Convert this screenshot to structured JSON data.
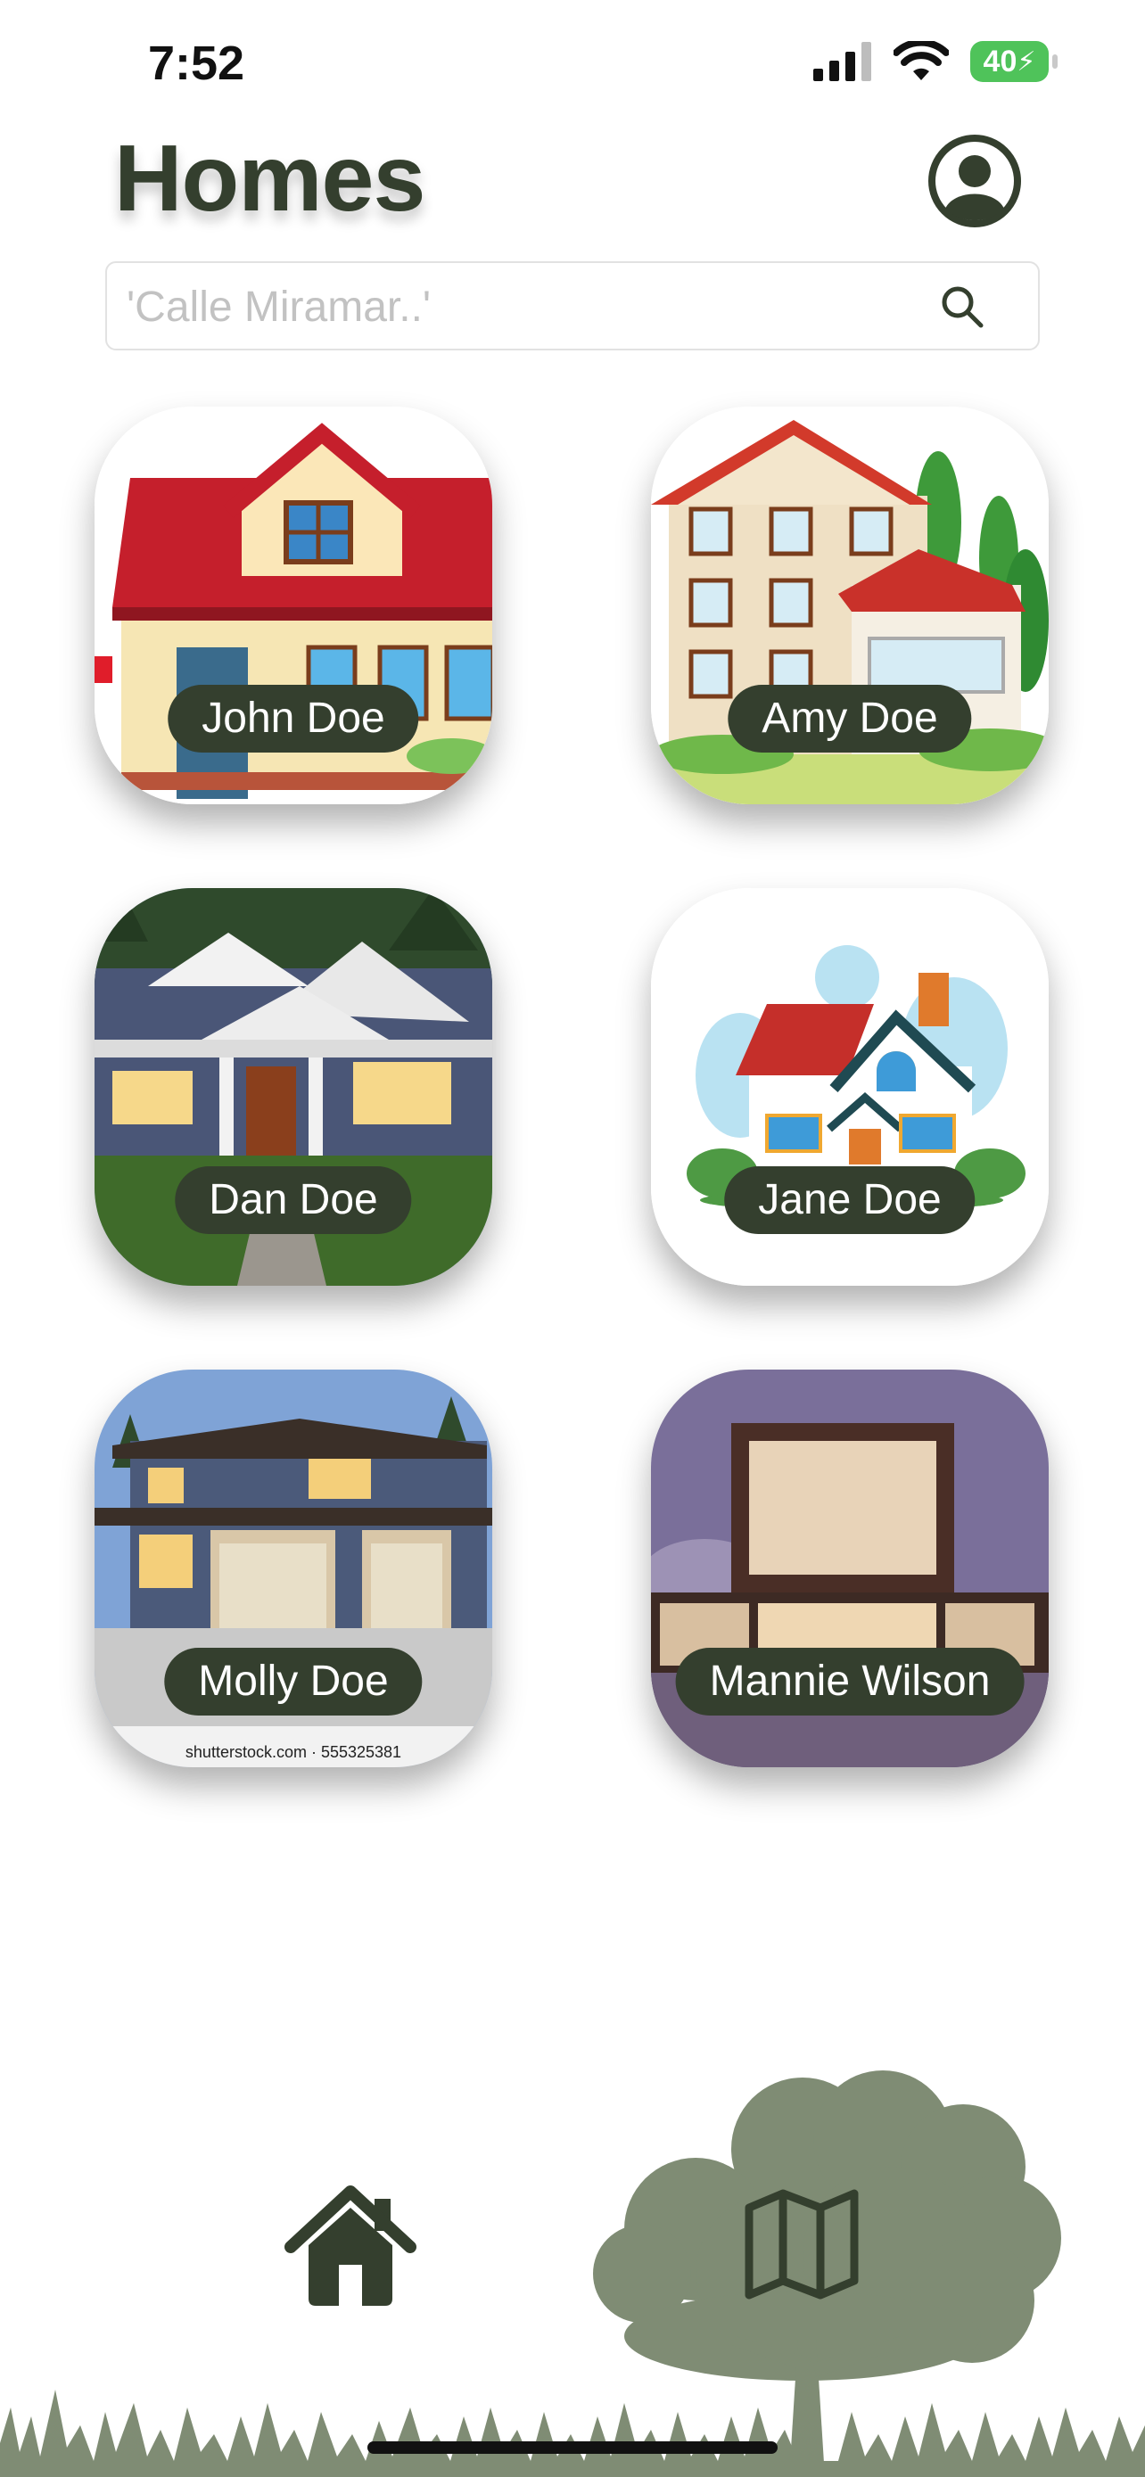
{
  "status_bar": {
    "time": "7:52",
    "battery": "40"
  },
  "header": {
    "title": "Homes"
  },
  "search": {
    "placeholder": "'Calle Miramar..'",
    "value": ""
  },
  "homes": [
    {
      "name": "John Doe"
    },
    {
      "name": "Amy Doe"
    },
    {
      "name": "Dan Doe"
    },
    {
      "name": "Jane Doe"
    },
    {
      "name": "Molly Doe",
      "watermark": "shutterstock.com · 555325381"
    },
    {
      "name": "Mannie Wilson"
    }
  ],
  "tab_bar": {
    "items": [
      {
        "icon": "home-icon",
        "active": true
      },
      {
        "icon": "map-icon",
        "active": false
      }
    ]
  },
  "colors": {
    "primary": "#343f2e",
    "tree": "#7f8c74",
    "battery": "#4fc35a"
  }
}
